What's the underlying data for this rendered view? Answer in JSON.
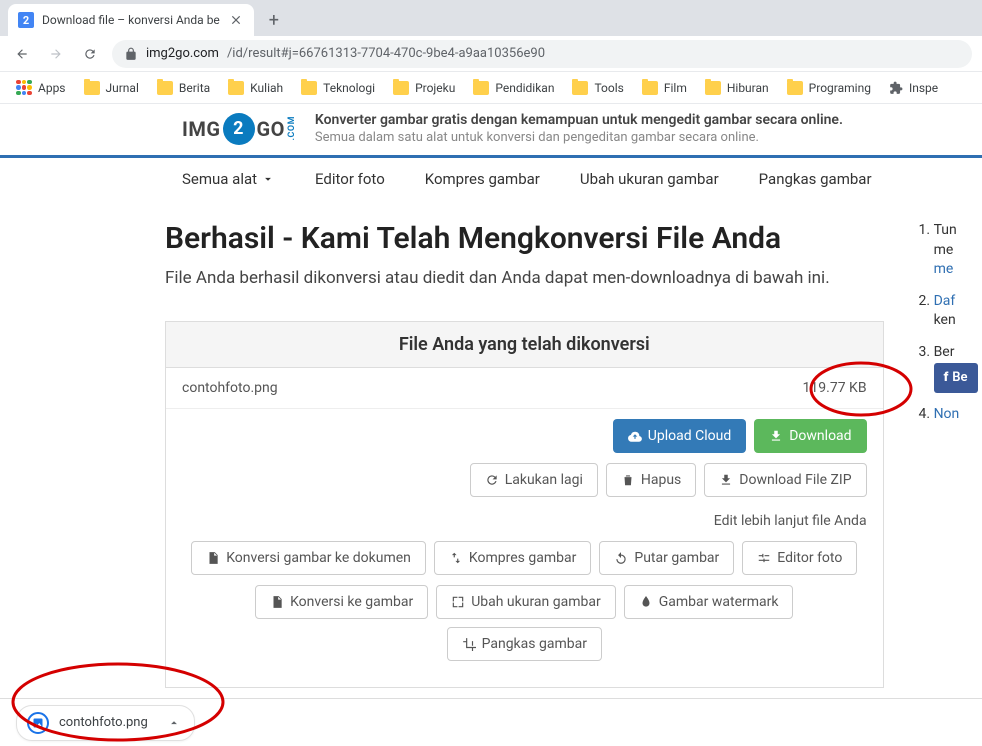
{
  "browser": {
    "tab_title": "Download file – konversi Anda be",
    "tab_favicon_text": "2",
    "url_host": "img2go.com",
    "url_path": "/id/result#j=66761313-7704-470c-9be4-a9aa10356e90",
    "bookmarks": [
      "Apps",
      "Jurnal",
      "Berita",
      "Kuliah",
      "Teknologi",
      "Projeku",
      "Pendidikan",
      "Tools",
      "Film",
      "Hiburan",
      "Programing",
      "Inspe"
    ]
  },
  "header": {
    "logo_front": "IMG",
    "logo_back": "GO",
    "logo_com": ".COM",
    "tagline_main": "Konverter gambar gratis dengan kemampuan untuk mengedit gambar secara online.",
    "tagline_sub": "Semua dalam satu alat untuk konversi dan pengeditan gambar secara online."
  },
  "nav": {
    "all_tools": "Semua alat",
    "items": [
      "Editor foto",
      "Kompres gambar",
      "Ubah ukuran gambar",
      "Pangkas gambar"
    ]
  },
  "page": {
    "h1": "Berhasil - Kami Telah Mengkonversi File Anda",
    "lead": "File Anda berhasil dikonversi atau diedit dan Anda dapat men-downloadnya di bawah ini."
  },
  "panel": {
    "head": "File Anda yang telah dikonversi",
    "file_name": "contohfoto.png",
    "file_size": "119.77 KB",
    "upload_cloud": "Upload Cloud",
    "download": "Download",
    "retry": "Lakukan lagi",
    "delete": "Hapus",
    "download_zip": "Download File ZIP",
    "edit_more": "Edit lebih lanjut file Anda",
    "tools_row1": [
      "Konversi gambar ke dokumen",
      "Kompres gambar",
      "Putar gambar",
      "Editor foto"
    ],
    "tools_row2": [
      "Konversi ke gambar",
      "Ubah ukuran gambar",
      "Gambar watermark",
      "Pangkas gambar"
    ]
  },
  "sidebar": {
    "items": [
      {
        "pre": "Tun",
        "line2": "me",
        "link": "me"
      },
      {
        "link": "Daf",
        "line2": "ken"
      },
      {
        "pre": "Ber"
      },
      {
        "link": "Non"
      }
    ],
    "fb_label": "Be"
  },
  "download_bar": {
    "file": "contohfoto.png"
  }
}
